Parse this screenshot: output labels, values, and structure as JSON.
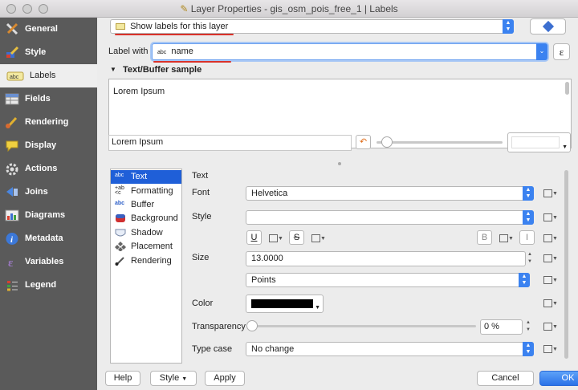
{
  "window": {
    "title": "Layer Properties - gis_osm_pois_free_1 | Labels"
  },
  "sidebar": {
    "items": [
      {
        "label": "General",
        "icon": "wrench-screwdriver-icon"
      },
      {
        "label": "Style",
        "icon": "paintbrush-icon"
      },
      {
        "label": "Labels",
        "icon": "abc-label-icon"
      },
      {
        "label": "Fields",
        "icon": "table-icon"
      },
      {
        "label": "Rendering",
        "icon": "brush-icon"
      },
      {
        "label": "Display",
        "icon": "speech-bubble-icon"
      },
      {
        "label": "Actions",
        "icon": "gear-icon"
      },
      {
        "label": "Joins",
        "icon": "join-arrow-icon"
      },
      {
        "label": "Diagrams",
        "icon": "chart-icon"
      },
      {
        "label": "Metadata",
        "icon": "info-icon"
      },
      {
        "label": "Variables",
        "icon": "epsilon-icon"
      },
      {
        "label": "Legend",
        "icon": "legend-icon"
      }
    ]
  },
  "labels_mode": {
    "value": "Show labels for this layer"
  },
  "label_with": {
    "label": "Label with",
    "value": "name"
  },
  "sample": {
    "heading": "Text/Buffer sample",
    "preview_text": "Lorem Ipsum",
    "input_value": "Lorem Ipsum"
  },
  "tree": {
    "items": [
      "Text",
      "Formatting",
      "Buffer",
      "Background",
      "Shadow",
      "Placement",
      "Rendering"
    ]
  },
  "text_panel": {
    "section": "Text",
    "font_label": "Font",
    "font_value": "Helvetica",
    "style_label": "Style",
    "style_value": "",
    "underline": "U",
    "strike": "S",
    "bold": "B",
    "italic": "I",
    "size_label": "Size",
    "size_value": "13.0000",
    "size_unit": "Points",
    "color_label": "Color",
    "color_value": "#000000",
    "transparency_label": "Transparency",
    "transparency_value": "0 %",
    "typecase_label": "Type case",
    "typecase_value": "No change"
  },
  "footer": {
    "help": "Help",
    "style": "Style",
    "apply": "Apply",
    "cancel": "Cancel",
    "ok": "OK"
  },
  "colors": {
    "accent": "#3b82f0",
    "sidebar": "#5a5a5a",
    "selection": "#1f5fd8",
    "annotation": "#d9322a"
  }
}
